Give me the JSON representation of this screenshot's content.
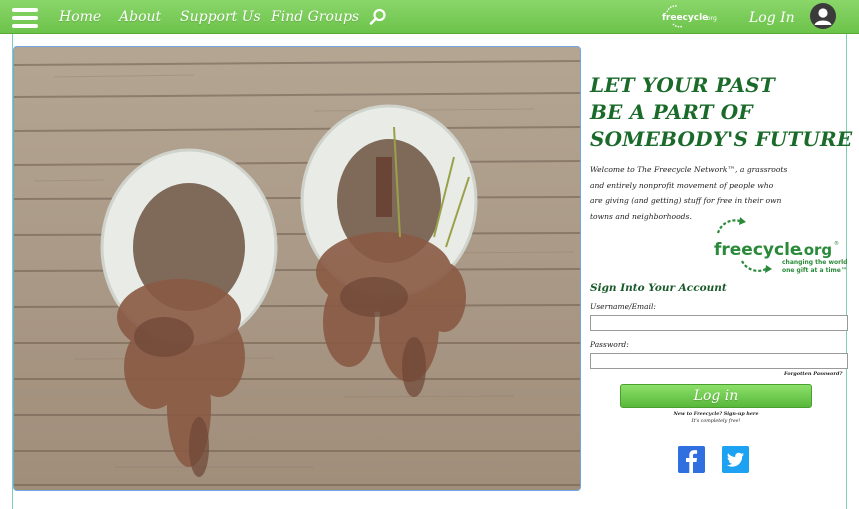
{
  "nav": {
    "items": [
      {
        "label": "Home"
      },
      {
        "label": "About"
      },
      {
        "label": "Support Us"
      },
      {
        "label": "Find Groups"
      }
    ],
    "login_label": "Log In",
    "search_icon": "search-icon",
    "menu_icon": "hamburger-menu-icon",
    "avatar_icon": "user-avatar-icon",
    "brand": "freecycle.org"
  },
  "hero": {
    "tagline": [
      "LET YOUR PAST",
      "BE A PART OF",
      "SOMEBODY'S FUTURE"
    ],
    "welcome_lines": [
      "Welcome to The Freecycle Network™, a grassroots",
      "and entirely nonprofit movement of people who",
      "are giving (and getting) stuff for free in their own",
      "towns and neighborhoods."
    ],
    "logo": {
      "name": "freecycle.org",
      "slogan_line1": "changing the world",
      "slogan_line2": "one gift at a time™"
    }
  },
  "signin": {
    "title": "Sign Into Your Account",
    "username_label": "Username/Email:",
    "username_value": "",
    "password_label": "Password:",
    "password_value": "",
    "forgot_label": "Forgotten Password?",
    "login_button": "Log in",
    "signup_prompt": "New to Freecycle? Sign-up here",
    "signup_free": "It's completely free!"
  },
  "social": {
    "facebook_icon": "facebook-icon",
    "twitter_icon": "twitter-icon"
  },
  "colors": {
    "nav_green": "#6cc34a",
    "tagline_green": "#1a6a2a",
    "facebook_blue": "#2f6fe0",
    "twitter_blue": "#1da1f2"
  }
}
